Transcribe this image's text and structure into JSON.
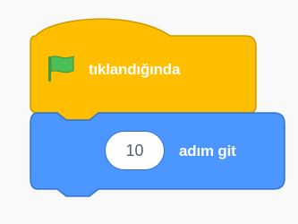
{
  "colors": {
    "events_fill": "#ffbf00",
    "events_stroke": "#cc9900",
    "motion_fill": "#4c97ff",
    "motion_stroke": "#3373cc",
    "flag_green": "#4cbf56",
    "background": "#f9f9f9"
  },
  "hat_block": {
    "icon": "green-flag-icon",
    "label": "tıklandığında"
  },
  "motion_block": {
    "input_value": "10",
    "label": "adım git"
  }
}
